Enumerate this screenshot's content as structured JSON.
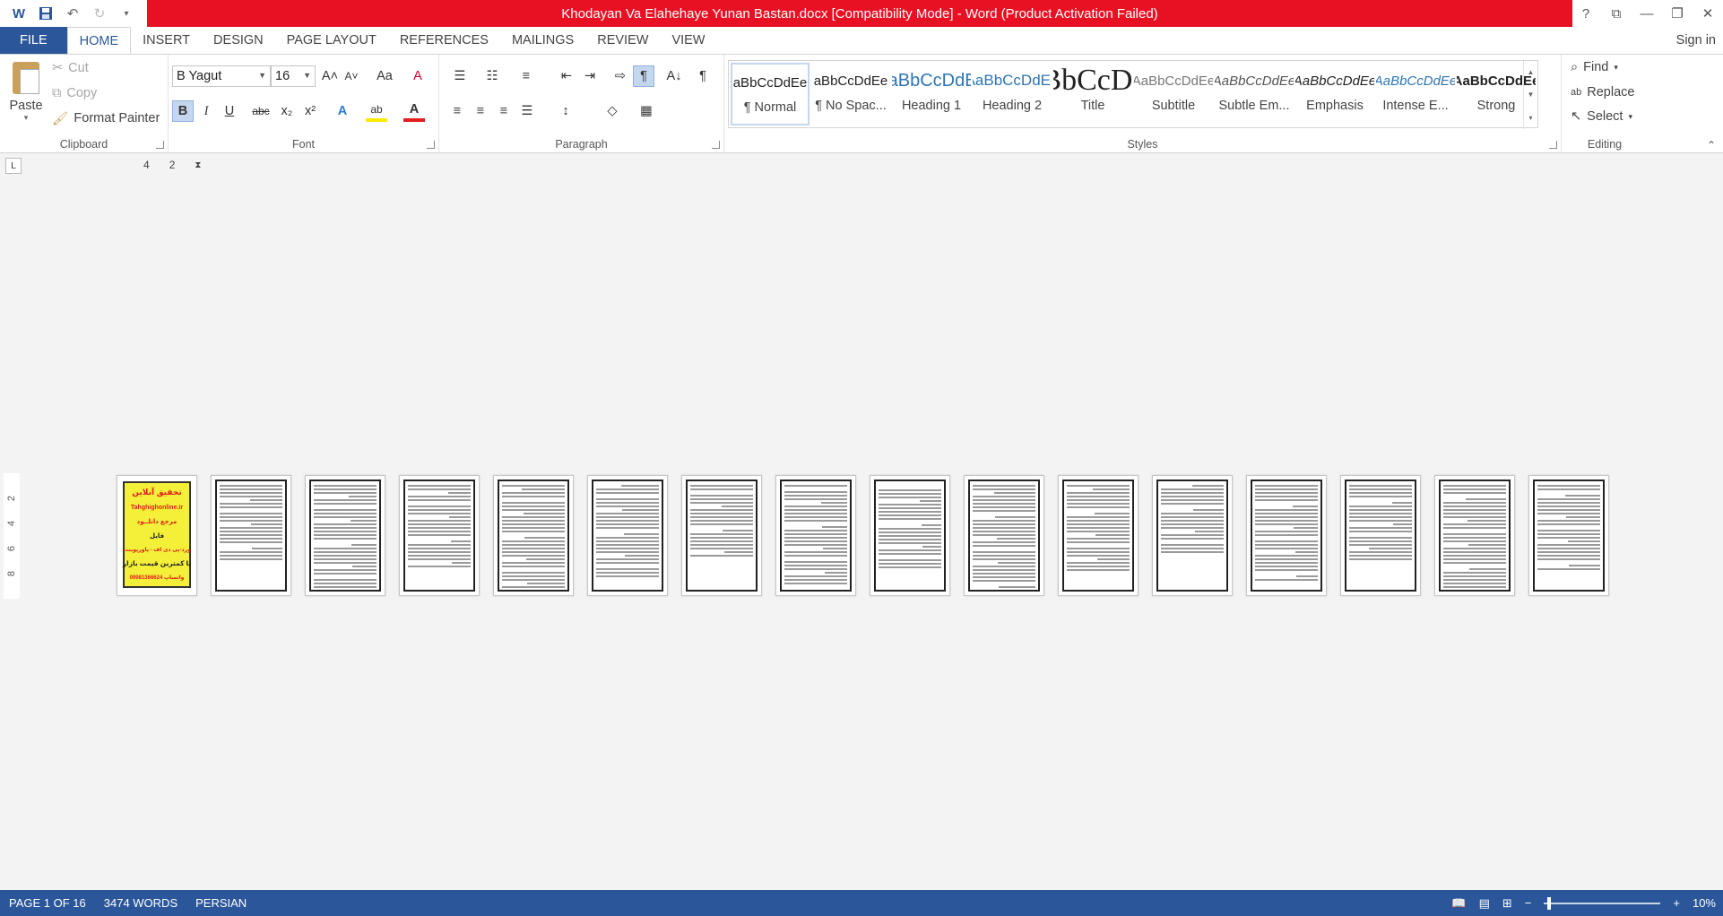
{
  "window": {
    "title": "Khodayan Va Elahehaye Yunan Bastan.docx [Compatibility Mode]  -  Word (Product Activation Failed)",
    "controls": [
      "?",
      "⧉",
      "—",
      "❐",
      "✕"
    ]
  },
  "quick_access": {
    "word_icon": "W",
    "save": "💾",
    "undo": "↶",
    "redo": "↻",
    "customize": "▾"
  },
  "tabs": [
    "FILE",
    "HOME",
    "INSERT",
    "DESIGN",
    "PAGE LAYOUT",
    "REFERENCES",
    "MAILINGS",
    "REVIEW",
    "VIEW"
  ],
  "active_tab": "HOME",
  "sign_in": "Sign in",
  "clipboard": {
    "paste": "Paste",
    "cut": "Cut",
    "copy": "Copy",
    "format_painter": "Format Painter",
    "label": "Clipboard"
  },
  "font": {
    "name": "B Yagut",
    "size": "16",
    "grow": "A˄",
    "shrink": "A˅",
    "case": "Aa",
    "clear": "A",
    "bold": "B",
    "italic": "I",
    "underline": "U",
    "strike": "abc",
    "subscript": "x₂",
    "superscript": "x²",
    "text_effects": "A",
    "highlight": "ab",
    "font_color": "A",
    "label": "Font"
  },
  "paragraph": {
    "label": "Paragraph",
    "pilcrow": "¶",
    "sort": "A↓"
  },
  "styles": {
    "label": "Styles",
    "items": [
      {
        "sample": "aBbCcDdEe",
        "name": "¶ Normal"
      },
      {
        "sample": "aBbCcDdEe",
        "name": "¶ No Spac..."
      },
      {
        "sample": "AaBbCcDdEe",
        "name": "Heading 1"
      },
      {
        "sample": "AaBbCcDdEe",
        "name": "Heading 2"
      },
      {
        "sample": "AaBbCcDdEe",
        "name": "Title"
      },
      {
        "sample": "AaBbCcDdEe",
        "name": "Subtitle"
      },
      {
        "sample": "AaBbCcDdEe",
        "name": "Subtle Em..."
      },
      {
        "sample": "AaBbCcDdEe",
        "name": "Emphasis"
      },
      {
        "sample": "AaBbCcDdEe",
        "name": "Intense E..."
      },
      {
        "sample": "AaBbCcDdEe",
        "name": "Strong"
      }
    ]
  },
  "editing": {
    "label": "Editing",
    "find": "Find",
    "replace": "Replace",
    "select": "Select"
  },
  "ruler": {
    "marks": [
      "4",
      "2"
    ],
    "vertical_marks": [
      "2",
      "4",
      "6",
      "8"
    ]
  },
  "cover_page": {
    "lines": [
      "تحقیق آنلاین",
      "Tahghighonline.ir",
      "مرجع دانلــود",
      "فایل",
      "ورد-پی دی اف - پاورپوینت",
      "با کمترین قیمت بازار",
      "09981366624 واتساپ"
    ]
  },
  "page_count": 16,
  "status": {
    "page": "PAGE 1 OF 16",
    "words": "3474 WORDS",
    "language": "PERSIAN",
    "zoom": "10%",
    "zoom_minus": "−",
    "zoom_plus": "+"
  },
  "colors": {
    "title_bar_alert": "#e81123",
    "word_blue": "#2b579a",
    "cover_yellow": "#f4f03a"
  }
}
